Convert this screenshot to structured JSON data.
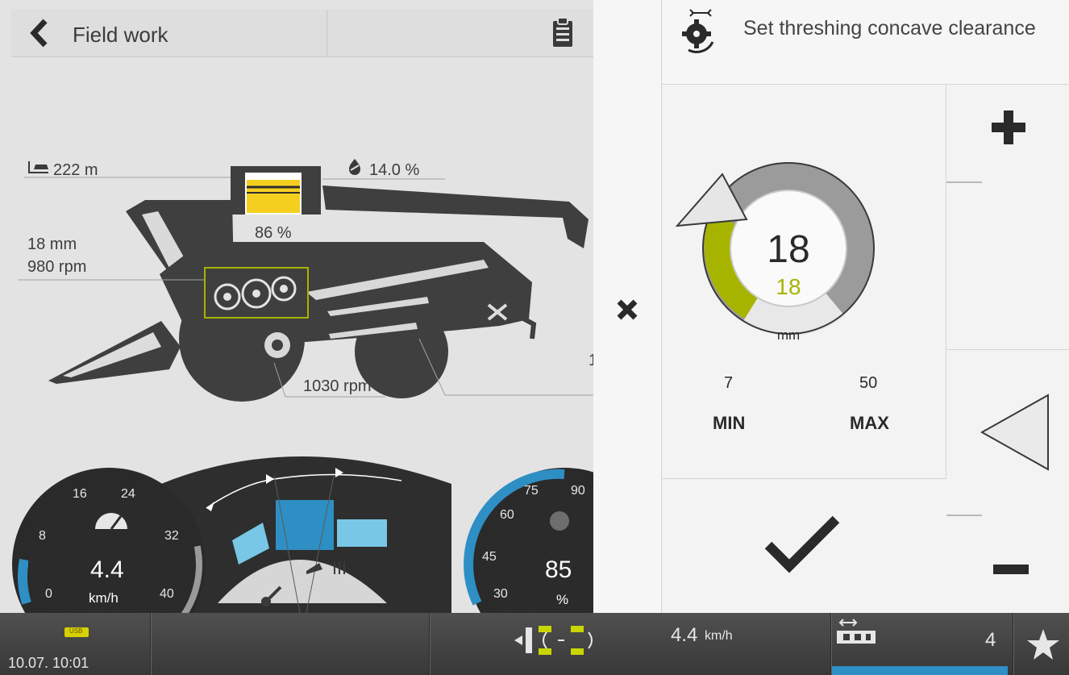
{
  "left_panel": {
    "title": "Field work",
    "readouts": {
      "distance": "222 m",
      "moisture": "14.0 %",
      "tank_fill": "86 %",
      "concave_mm": "18 mm",
      "drum_rpm": "980 rpm",
      "fan_rpm": "1030 rpm",
      "edge_digit": "1"
    }
  },
  "speed_gauge": {
    "ticks": [
      "16",
      "24",
      "8",
      "32",
      "0",
      "40"
    ],
    "value": "4.4",
    "unit": "km/h",
    "level": 4.4
  },
  "load_gauge": {
    "ticks": [
      "75",
      "90",
      "60",
      "45",
      "30"
    ],
    "value": "85",
    "unit": "%",
    "level": 85
  },
  "dialog": {
    "title": "Set threshing concave clearance",
    "current_value": "18",
    "set_value": "18",
    "unit": "mm",
    "min_value": "7",
    "max_value": "50",
    "min_label": "MIN",
    "max_label": "MAX"
  },
  "status_bar": {
    "usb_label": "USB",
    "datetime": "10.07.  10:01",
    "speed_value": "4.4",
    "speed_unit": "km/h",
    "header_count": "4"
  },
  "colors": {
    "accent_yellow": "#a6b400",
    "tank_yellow": "#f5cf1f",
    "gauge_blue": "#2e8fc4",
    "light_blue": "#78c7e6"
  },
  "icons": {
    "back": "chevron-left-icon",
    "clipboard": "clipboard-icon",
    "close": "close-icon",
    "ok": "check-icon",
    "plus": "plus-icon",
    "minus": "minus-icon",
    "favorite": "star-icon"
  }
}
